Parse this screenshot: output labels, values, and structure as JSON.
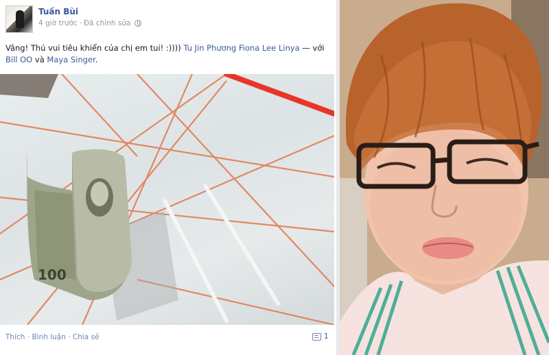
{
  "post": {
    "author": "Tuấn Bùi",
    "timestamp": "4 giờ trước",
    "dot": "·",
    "edited": "Đã chỉnh sửa",
    "privacy_icon": "globe-icon",
    "status": {
      "text_before": "Vâng! Thú vui tiêu khiển của chị em tui! :)))) ",
      "tag1": "Tu Jin Phương",
      "space1": " ",
      "tag2": "Fiona Lee Linya",
      "text_dash": " — với ",
      "tag3": "Bill OO",
      "text_and": " và ",
      "tag4": "Maya Singer",
      "text_end": "."
    },
    "actions": {
      "like": "Thích",
      "comment": "Bình luận",
      "share": "Chia sẻ",
      "sep": " · "
    },
    "comment_count": "1",
    "comment_icon": "comment-icon"
  },
  "colors": {
    "link": "#3b5998",
    "meta": "#9197a3",
    "actions": "#6d84b4"
  }
}
